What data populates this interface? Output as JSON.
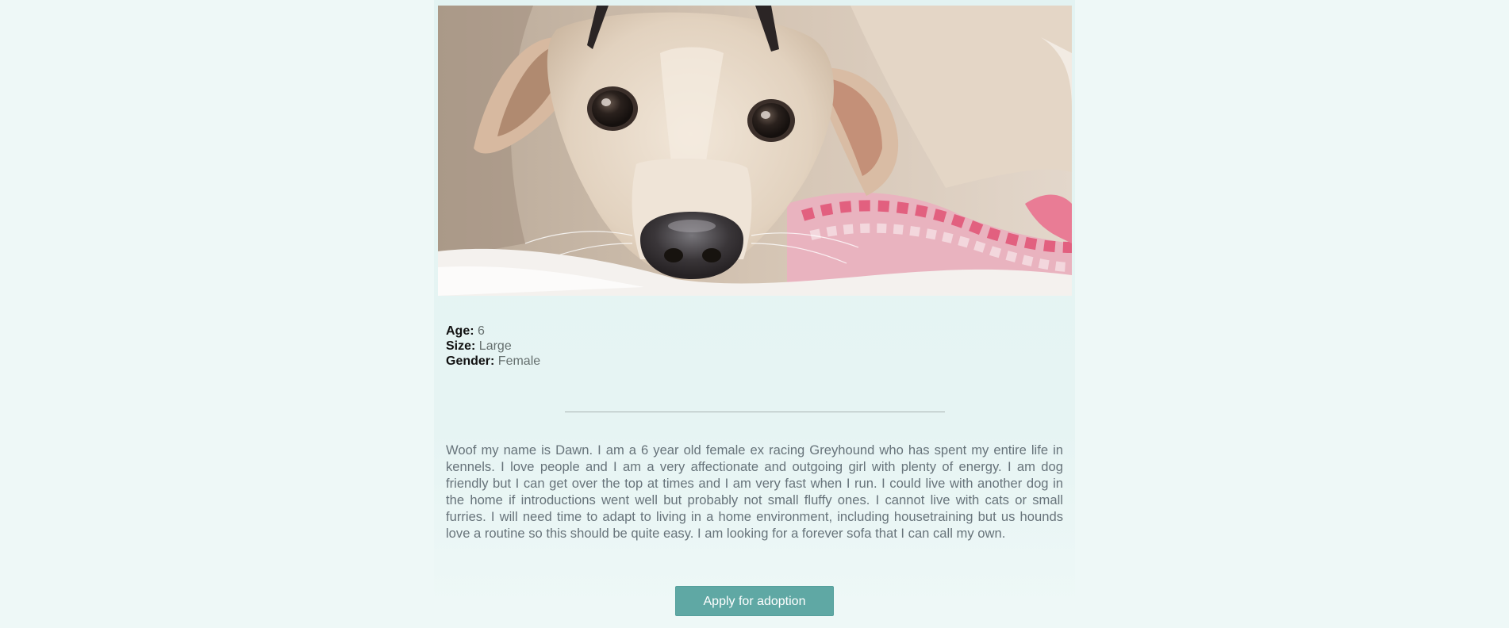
{
  "photo": {
    "subject": "dog-photo",
    "colors": {
      "fur": "#e6d6c4",
      "background": "#cdbcaa",
      "blanket": "#f4f1ee",
      "rope_pink": "#e86a86",
      "nose": "#3b3638"
    }
  },
  "facts": {
    "age_label": "Age:",
    "age_value": "6",
    "size_label": "Size:",
    "size_value": "Large",
    "gender_label": "Gender:",
    "gender_value": "Female"
  },
  "bio": "Woof my name is Dawn. I am a 6 year old female ex racing Greyhound who has spent my entire life in kennels. I love people and I am a very affectionate and outgoing girl with plenty of energy. I am dog friendly but I can get over the top at times and I am very fast when I run. I could live with another dog in the home if introductions went well but probably not small fluffy ones. I cannot live with cats or small furries. I will need time to adapt to living in a home environment, including housetraining but us hounds love a routine so this should be quite easy. I am looking for a forever sofa that I can call my own.",
  "actions": {
    "apply_label": "Apply for adoption"
  },
  "colors": {
    "page_bg": "#eef8f7",
    "card_bg": "#e3f3f2",
    "button_bg": "#5fa8a4",
    "divider": "#a9b3b3"
  }
}
